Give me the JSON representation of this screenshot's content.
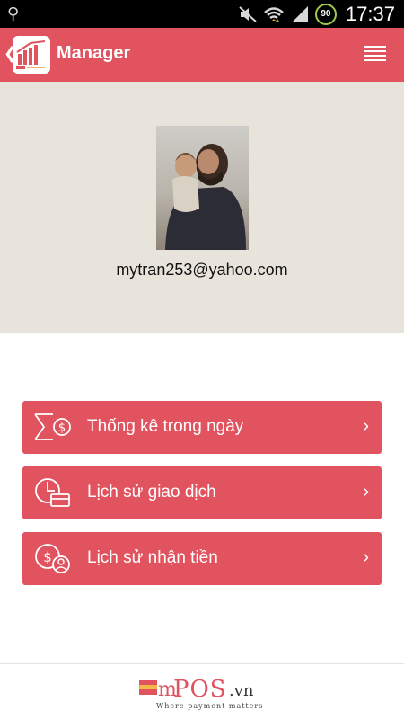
{
  "status_bar": {
    "time": "17:37",
    "battery": "90",
    "icons": [
      "usb-icon",
      "mute-icon",
      "wifi-icon",
      "signal-icon",
      "battery-icon"
    ]
  },
  "app_bar": {
    "title": "Manager",
    "back_icon": "chevron-left-icon",
    "menu_icon": "hamburger-icon"
  },
  "profile": {
    "email": "mytran253@yahoo.com"
  },
  "menu": {
    "items": [
      {
        "label": "Thống kê trong ngày",
        "icon": "daily-stats-icon"
      },
      {
        "label": "Lịch sử giao dịch",
        "icon": "transaction-history-icon"
      },
      {
        "label": "Lịch sử nhận tiền",
        "icon": "received-money-icon"
      }
    ]
  },
  "footer": {
    "brand_prefix": "m",
    "brand_main": "POS",
    "brand_suffix": ".vn",
    "tagline": "Where payment matters"
  },
  "colors": {
    "primary": "#e0535f",
    "profile_bg": "#e8e4dc",
    "status_bar": "#000000",
    "battery_ring": "#9ec94b"
  }
}
